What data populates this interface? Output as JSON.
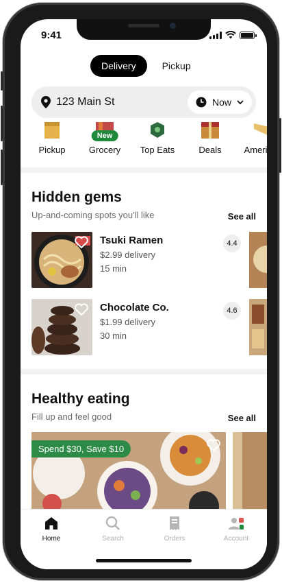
{
  "status_bar": {
    "time": "9:41"
  },
  "mode_toggle": {
    "delivery_label": "Delivery",
    "pickup_label": "Pickup"
  },
  "address": {
    "text": "123 Main St",
    "time_label": "Now"
  },
  "categories": [
    {
      "label": "Pickup",
      "icon": "bag-icon"
    },
    {
      "label": "Grocery",
      "icon": "grocery-icon",
      "badge": "New"
    },
    {
      "label": "Top Eats",
      "icon": "top-eats-icon"
    },
    {
      "label": "Deals",
      "icon": "deals-icon"
    },
    {
      "label": "American",
      "icon": "american-icon"
    }
  ],
  "hidden_gems": {
    "title": "Hidden gems",
    "subtitle": "Up-and-coming spots you'll like",
    "see_all": "See all",
    "stores": [
      {
        "name": "Tsuki Ramen",
        "fee": "$2.99 delivery",
        "time": "15 min",
        "rating": "4.4"
      },
      {
        "name": "Chocolate Co.",
        "fee": "$1.99 delivery",
        "time": "30 min",
        "rating": "4.6"
      }
    ]
  },
  "healthy_eating": {
    "title": "Healthy eating",
    "subtitle": "Fill up and feel good",
    "see_all": "See all",
    "promo": "Spend $30, Save $10"
  },
  "tabs": [
    {
      "label": "Home",
      "icon": "home-icon",
      "active": true
    },
    {
      "label": "Search",
      "icon": "search-icon",
      "active": false
    },
    {
      "label": "Orders",
      "icon": "orders-icon",
      "active": false
    },
    {
      "label": "Account",
      "icon": "account-icon",
      "active": false
    }
  ],
  "colors": {
    "accent_green": "#1f8a3b",
    "primary": "#000000"
  }
}
